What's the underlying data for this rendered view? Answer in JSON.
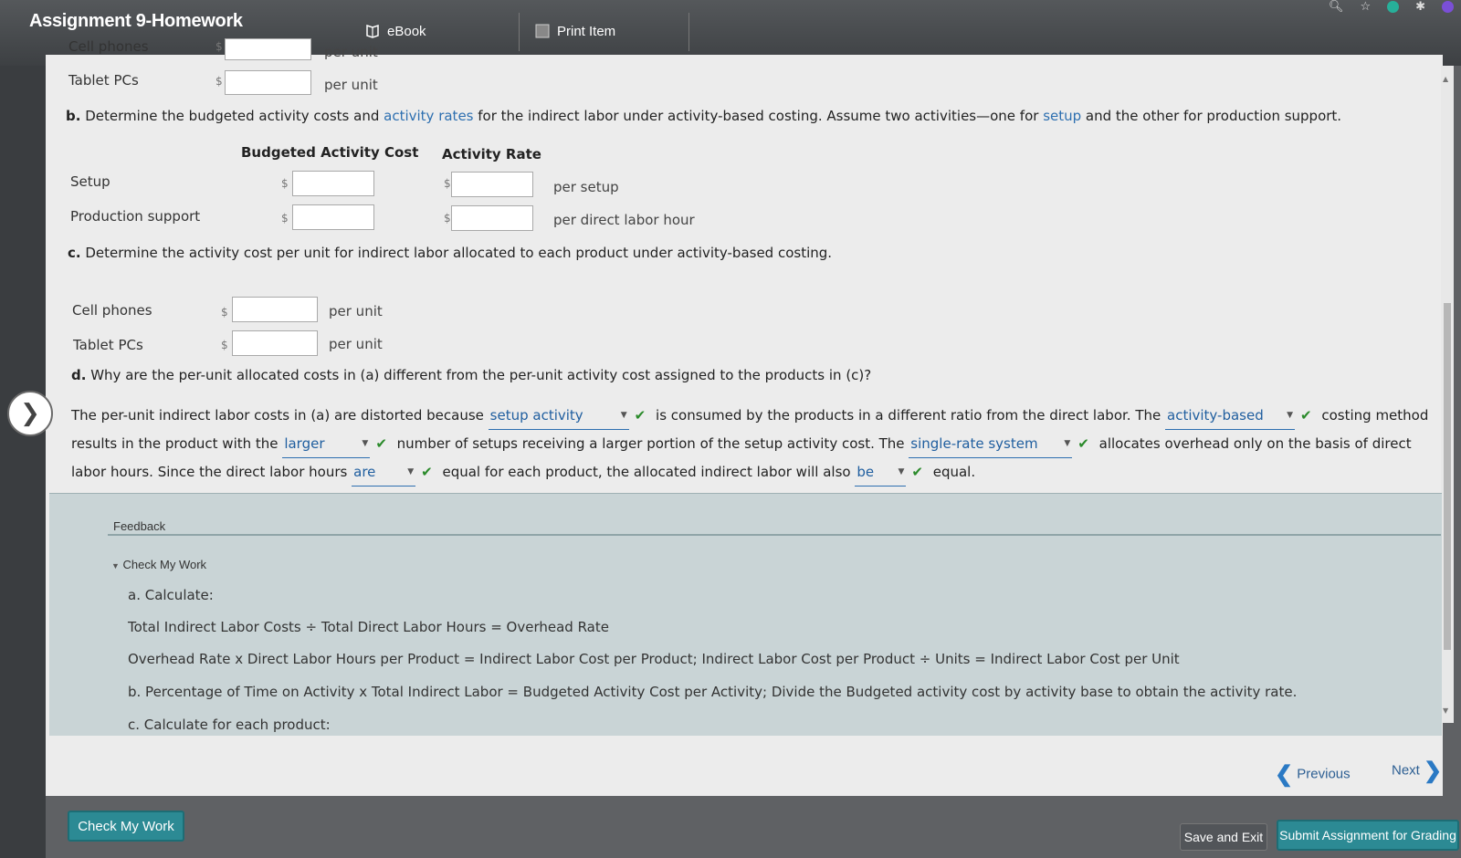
{
  "header": {
    "app_title": "Assignment 9-Homework",
    "ebook_label": "eBook",
    "print_label": "Print Item"
  },
  "part_a_cont": {
    "rows": [
      {
        "label": "Cell phones",
        "currency": "$",
        "unit": "per unit"
      },
      {
        "label": "Tablet PCs",
        "currency": "$",
        "unit": "per unit"
      }
    ]
  },
  "part_b": {
    "letter": "b.",
    "question_pre": "Determine the budgeted activity costs and ",
    "question_link1": "activity rates",
    "question_mid": " for the indirect labor under activity-based costing. Assume two activities—one for ",
    "question_link2": "setup",
    "question_post": " and the other for production support.",
    "col_cost": "Budgeted Activity Cost",
    "col_rate": "Activity Rate",
    "rows": [
      {
        "label": "Setup",
        "currency": "$",
        "unit": "per setup"
      },
      {
        "label": "Production support",
        "currency": "$",
        "unit": "per direct labor hour"
      }
    ]
  },
  "part_c": {
    "letter": "c.",
    "question": "Determine the activity cost per unit for indirect labor allocated to each product under activity-based costing.",
    "rows": [
      {
        "label": "Cell phones",
        "currency": "$",
        "unit": "per unit"
      },
      {
        "label": "Tablet PCs",
        "currency": "$",
        "unit": "per unit"
      }
    ]
  },
  "part_d": {
    "letter": "d.",
    "question": "Why are the per-unit allocated costs in (a) different from the per-unit activity cost assigned to the products in (c)?",
    "t1": "The per-unit indirect labor costs in (a) are distorted because",
    "dd1": "setup activity",
    "t2": "is consumed by the products in a different ratio from the direct labor. The",
    "dd2": "activity-based",
    "t3": "costing method",
    "t4": "results in the product with the",
    "dd3": "larger",
    "t5": "number of setups receiving a larger portion of the setup activity cost. The",
    "dd4": "single-rate system",
    "t6": "allocates overhead only on the basis of direct",
    "t7": "labor hours. Since the direct labor hours",
    "dd5": "are",
    "t8": "equal for each product, the allocated indirect labor will also",
    "dd6": "be",
    "t9": "equal.",
    "check": "✔"
  },
  "feedback": {
    "label": "Feedback",
    "check_my_work": "Check My Work",
    "lines": [
      "a. Calculate:",
      "Total Indirect Labor Costs ÷ Total Direct Labor Hours = Overhead Rate",
      "Overhead Rate x Direct Labor Hours per Product = Indirect Labor Cost per Product; Indirect Labor Cost per Product ÷ Units = Indirect Labor Cost per Unit",
      "b. Percentage of Time on Activity x Total Indirect Labor = Budgeted Activity Cost per Activity; Divide the Budgeted activity cost by activity base to obtain the activity rate.",
      "c. Calculate for each product:"
    ]
  },
  "nav": {
    "previous": "Previous",
    "next": "Next"
  },
  "buttons": {
    "check_my_work": "Check My Work",
    "save_exit": "Save and Exit",
    "submit": "Submit Assignment for Grading"
  }
}
